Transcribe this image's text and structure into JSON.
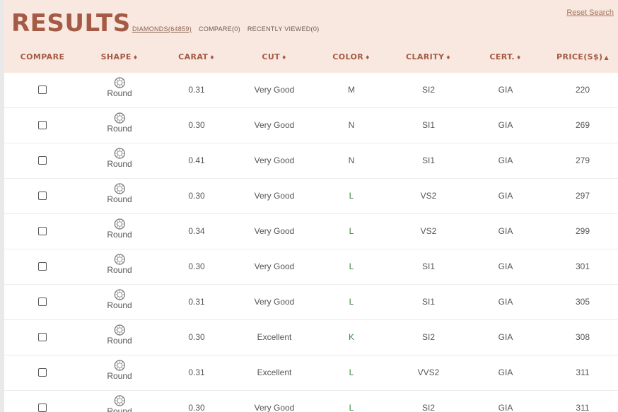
{
  "header": {
    "title": "RESULTS",
    "tabs": {
      "diamonds": "DIAMONDS(64859)",
      "compare": "COMPARE(0)",
      "recently_viewed": "RECENTLY VIEWED(0)"
    },
    "reset_label": "Reset Search"
  },
  "columns": {
    "compare": "COMPARE",
    "shape": "SHAPE",
    "carat": "CARAT",
    "cut": "CUT",
    "color": "COLOR",
    "clarity": "CLARITY",
    "cert": "CERT.",
    "price": "PRICE(S$)"
  },
  "sort": {
    "column": "price",
    "direction": "ascending"
  },
  "colors": {
    "accent": "#a55a45",
    "header_bg": "#f8e8df",
    "grade_green": "#3c8a3c"
  },
  "rows": [
    {
      "shape": "Round",
      "carat": "0.31",
      "cut": "Very Good",
      "color": "M",
      "clarity": "SI2",
      "cert": "GIA",
      "price": "220"
    },
    {
      "shape": "Round",
      "carat": "0.30",
      "cut": "Very Good",
      "color": "N",
      "clarity": "SI1",
      "cert": "GIA",
      "price": "269"
    },
    {
      "shape": "Round",
      "carat": "0.41",
      "cut": "Very Good",
      "color": "N",
      "clarity": "SI1",
      "cert": "GIA",
      "price": "279"
    },
    {
      "shape": "Round",
      "carat": "0.30",
      "cut": "Very Good",
      "color": "L",
      "clarity": "VS2",
      "cert": "GIA",
      "price": "297"
    },
    {
      "shape": "Round",
      "carat": "0.34",
      "cut": "Very Good",
      "color": "L",
      "clarity": "VS2",
      "cert": "GIA",
      "price": "299"
    },
    {
      "shape": "Round",
      "carat": "0.30",
      "cut": "Very Good",
      "color": "L",
      "clarity": "SI1",
      "cert": "GIA",
      "price": "301"
    },
    {
      "shape": "Round",
      "carat": "0.31",
      "cut": "Very Good",
      "color": "L",
      "clarity": "SI1",
      "cert": "GIA",
      "price": "305"
    },
    {
      "shape": "Round",
      "carat": "0.30",
      "cut": "Excellent",
      "color": "K",
      "clarity": "SI2",
      "cert": "GIA",
      "price": "308"
    },
    {
      "shape": "Round",
      "carat": "0.31",
      "cut": "Excellent",
      "color": "L",
      "clarity": "VVS2",
      "cert": "GIA",
      "price": "311"
    },
    {
      "shape": "Round",
      "carat": "0.30",
      "cut": "Very Good",
      "color": "L",
      "clarity": "SI2",
      "cert": "GIA",
      "price": "311"
    }
  ]
}
